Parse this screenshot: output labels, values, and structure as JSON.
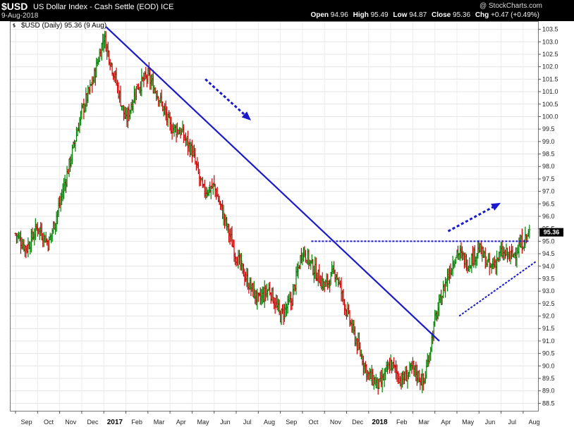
{
  "header": {
    "symbol": "$USD",
    "description": "US Dollar Index - Cash Settle (EOD)  ICE",
    "date": "9-Aug-2018",
    "watermark": "@ StockCharts.com",
    "open_label": "Open",
    "open": "94.96",
    "high_label": "High",
    "high": "95.49",
    "low_label": "Low",
    "low": "94.87",
    "close_label": "Close",
    "close": "95.36",
    "chg_label": "Chg",
    "chg": "+0.47 (+0.49%)"
  },
  "legend": {
    "label": "$USD (Daily) 95.36 (9 Aug)"
  },
  "colors": {
    "up": "#008000",
    "down": "#cc0000",
    "annotation": "#1a1acc",
    "last_tag": "#000000"
  },
  "chart_data": {
    "type": "line",
    "title": "$USD (Daily) 95.36 (9 Aug)",
    "xlabel": "",
    "ylabel": "",
    "ylim": [
      88.2,
      103.8
    ],
    "grid": true,
    "y_ticks": [
      "88.5",
      "89.0",
      "89.5",
      "90.0",
      "90.5",
      "91.0",
      "91.5",
      "92.0",
      "92.5",
      "93.0",
      "93.5",
      "94.0",
      "94.5",
      "95.0",
      "95.5",
      "96.0",
      "96.5",
      "97.0",
      "97.5",
      "98.0",
      "98.5",
      "99.0",
      "99.5",
      "100.0",
      "100.5",
      "101.0",
      "101.5",
      "102.0",
      "102.5",
      "103.0",
      "103.5"
    ],
    "x_ticks": [
      {
        "label": "Sep",
        "bold": false
      },
      {
        "label": "Oct",
        "bold": false
      },
      {
        "label": "Nov",
        "bold": false
      },
      {
        "label": "Dec",
        "bold": false
      },
      {
        "label": "2017",
        "bold": true
      },
      {
        "label": "Feb",
        "bold": false
      },
      {
        "label": "Mar",
        "bold": false
      },
      {
        "label": "Apr",
        "bold": false
      },
      {
        "label": "May",
        "bold": false
      },
      {
        "label": "Jun",
        "bold": false
      },
      {
        "label": "Jul",
        "bold": false
      },
      {
        "label": "Aug",
        "bold": false
      },
      {
        "label": "Sep",
        "bold": false
      },
      {
        "label": "Oct",
        "bold": false
      },
      {
        "label": "Nov",
        "bold": false
      },
      {
        "label": "Dec",
        "bold": false
      },
      {
        "label": "2018",
        "bold": true
      },
      {
        "label": "Feb",
        "bold": false
      },
      {
        "label": "Mar",
        "bold": false
      },
      {
        "label": "Apr",
        "bold": false
      },
      {
        "label": "May",
        "bold": false
      },
      {
        "label": "Jun",
        "bold": false
      },
      {
        "label": "Jul",
        "bold": false
      },
      {
        "label": "Aug",
        "bold": false
      }
    ],
    "price_path_months": [
      0,
      0.5,
      1,
      1.5,
      2,
      2.5,
      3,
      3.5,
      4,
      4.5,
      5,
      5.5,
      6,
      6.5,
      7,
      7.5,
      8,
      8.5,
      9,
      9.5,
      10,
      10.5,
      11,
      11.5,
      12,
      12.5,
      13,
      13.5,
      14,
      14.5,
      15,
      15.5,
      16,
      16.5,
      17,
      17.5,
      18,
      18.5,
      19,
      19.5,
      20,
      20.5,
      21,
      21.5,
      22,
      22.5,
      23,
      23.3
    ],
    "price_path_values": [
      95.3,
      94.7,
      95.6,
      94.9,
      96.5,
      98.3,
      100.2,
      101.4,
      103.2,
      101.6,
      99.8,
      101.2,
      101.6,
      100.8,
      99.6,
      99.4,
      98.6,
      97.0,
      97.2,
      95.8,
      94.4,
      93.4,
      92.6,
      93.1,
      92.0,
      92.6,
      94.7,
      93.9,
      93.2,
      93.8,
      92.2,
      90.8,
      89.6,
      89.2,
      90.1,
      89.4,
      89.9,
      89.3,
      91.8,
      93.4,
      94.6,
      94.1,
      94.7,
      93.9,
      94.5,
      94.4,
      95.0,
      95.36
    ],
    "last_value": "95.36",
    "annotations": {
      "downtrend_line": {
        "from": [
          4.1,
          103.6
        ],
        "to": [
          19.2,
          91.0
        ]
      },
      "resistance_line": {
        "from": [
          13.4,
          95.0
        ],
        "to": [
          23.3,
          95.0
        ],
        "value": 95.0
      },
      "support_line": {
        "from": [
          20.1,
          92.0
        ],
        "to": [
          23.6,
          94.2
        ]
      },
      "down_arrow": {
        "from": [
          8.6,
          101.5
        ],
        "to": [
          10.6,
          99.9
        ]
      },
      "up_arrow": {
        "from": [
          19.6,
          95.4
        ],
        "to": [
          21.9,
          96.5
        ]
      }
    }
  }
}
